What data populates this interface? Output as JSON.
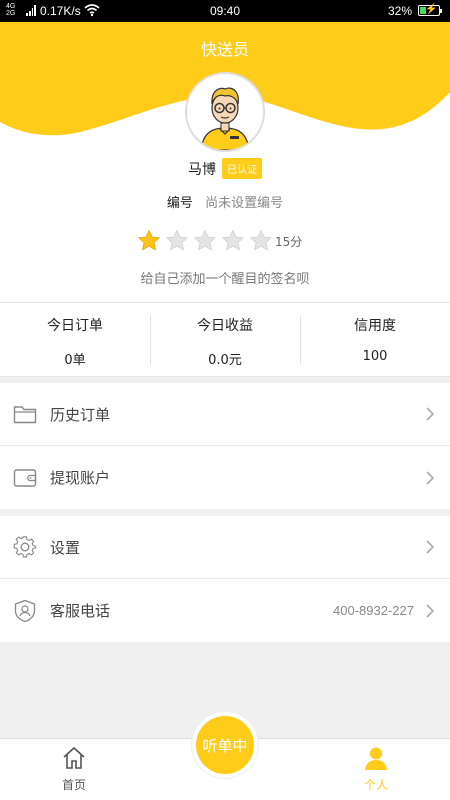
{
  "status_bar": {
    "network": "4G⁺ 2G",
    "speed": "0.17K/s",
    "time": "09:40",
    "battery_percent": "32%",
    "battery_level": 0.32,
    "icons": [
      "signal-icon",
      "wifi-icon",
      "battery-icon"
    ]
  },
  "header": {
    "title": "快送员",
    "brand_color": "#ffcc1a"
  },
  "profile": {
    "name": "马博",
    "verified_badge": "已认证",
    "id_label": "编号",
    "id_value": "尚未设置编号",
    "rating": 1,
    "rating_max": 5,
    "score": "15分",
    "slogan": "给自己添加一个醒目的签名呗"
  },
  "stats": [
    {
      "label": "今日订单",
      "value": "0单"
    },
    {
      "label": "今日收益",
      "value": "0.0元"
    },
    {
      "label": "信用度",
      "value": "100"
    }
  ],
  "menu": {
    "history_orders": "历史订单",
    "withdraw_account": "提现账户",
    "settings": "设置",
    "customer_service": "客服电话",
    "customer_service_phone": "400-8932-227"
  },
  "tabbar": {
    "home": "首页",
    "listen": "听单中",
    "profile": "个人",
    "active_color": "#ffcc1a"
  }
}
